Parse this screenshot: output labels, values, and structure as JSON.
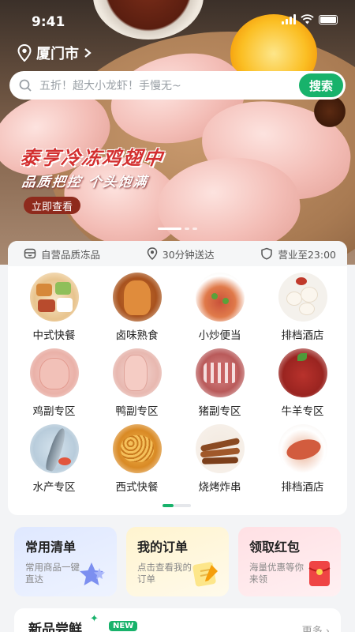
{
  "status_bar": {
    "time": "9:41"
  },
  "location": {
    "city": "厦门市"
  },
  "search": {
    "placeholder": "五折！超大小龙虾！手慢无~",
    "button": "搜索"
  },
  "banner": {
    "title": "泰亨冷冻鸡翅中",
    "subtitle": "品质把控  个头饱满",
    "cta": "立即查看"
  },
  "features": [
    {
      "icon": "box-icon",
      "label": "自营品质冻品"
    },
    {
      "icon": "location-pin-icon",
      "label": "30分钟送达"
    },
    {
      "icon": "shield-icon",
      "label": "营业至23:00"
    }
  ],
  "categories": [
    {
      "label": "中式快餐",
      "icon": "chinese-fastfood-icon",
      "color": "#f2d8b0"
    },
    {
      "label": "卤味熟食",
      "icon": "braised-food-icon",
      "color": "#d88a4a"
    },
    {
      "label": "小炒便当",
      "icon": "stir-fry-icon",
      "color": "#e89a7a"
    },
    {
      "label": "排档酒店",
      "icon": "buns-icon",
      "color": "#f4ece0"
    },
    {
      "label": "鸡副专区",
      "icon": "chicken-parts-icon",
      "color": "#f0c6c0"
    },
    {
      "label": "鸭副专区",
      "icon": "duck-parts-icon",
      "color": "#efc9c4"
    },
    {
      "label": "猪副专区",
      "icon": "pork-ribs-icon",
      "color": "#d98a8a"
    },
    {
      "label": "牛羊专区",
      "icon": "beef-icon",
      "color": "#c8453f"
    },
    {
      "label": "水产专区",
      "icon": "seafood-icon",
      "color": "#9fb7c8"
    },
    {
      "label": "西式快餐",
      "icon": "fried-chicken-icon",
      "color": "#e9a540"
    },
    {
      "label": "烧烤炸串",
      "icon": "skewer-icon",
      "color": "#a3673e"
    },
    {
      "label": "排档酒店",
      "icon": "fish-dish-icon",
      "color": "#e7c1a8"
    }
  ],
  "quick_links": [
    {
      "title": "常用清单",
      "sub": "常用商品一键直达",
      "icon": "star-icon"
    },
    {
      "title": "我的订单",
      "sub": "点击查看我的订单",
      "icon": "note-icon"
    },
    {
      "title": "领取红包",
      "sub": "海量优惠等你来领",
      "icon": "red-envelope-icon"
    }
  ],
  "new_products": {
    "title": "新品尝鲜",
    "badge": "NEW",
    "more": "更多"
  },
  "colors": {
    "accent": "#18b26b",
    "banner_title": "#d32f2f"
  }
}
